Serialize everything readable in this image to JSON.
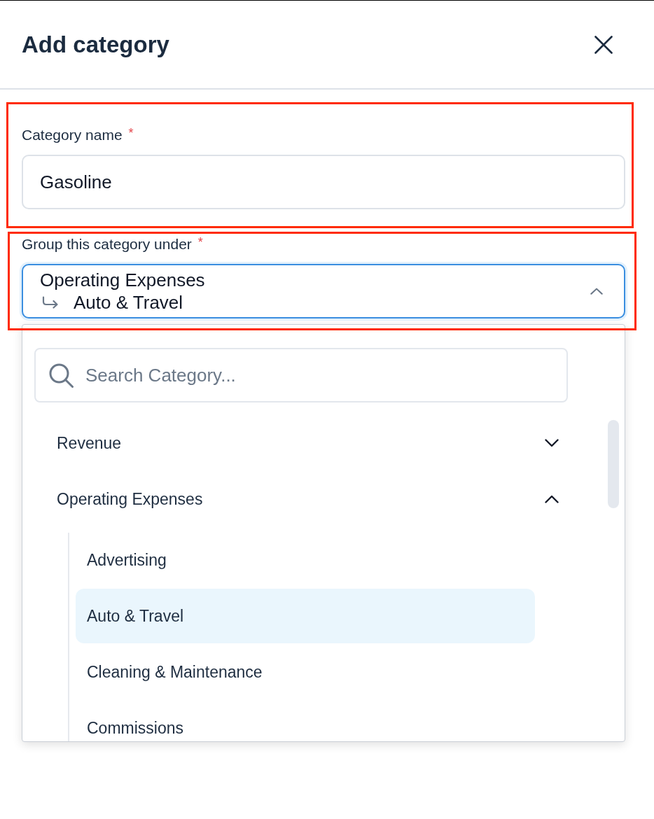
{
  "dialog": {
    "title": "Add category"
  },
  "fields": [
    {
      "kind": "text",
      "label": "Category name",
      "required_mark": "*",
      "value": "Gasoline",
      "highlighted": true
    },
    {
      "kind": "select",
      "label": "Group this category under",
      "required_mark": "*",
      "value": "Operating Expenses",
      "sub_value": "Auto & Travel",
      "expanded": true,
      "highlighted": true,
      "dropdown": {
        "search": {
          "placeholder": "Search Category..."
        },
        "items": [
          {
            "label": "Revenue",
            "expanded": false
          },
          {
            "label": "Operating Expenses",
            "expanded": true,
            "children": [
              {
                "label": "Advertising",
                "selected": false
              },
              {
                "label": "Auto & Travel",
                "selected": true
              },
              {
                "label": "Cleaning & Maintenance",
                "selected": false
              },
              {
                "label": "Commissions",
                "selected": false
              }
            ]
          }
        ]
      }
    }
  ]
}
